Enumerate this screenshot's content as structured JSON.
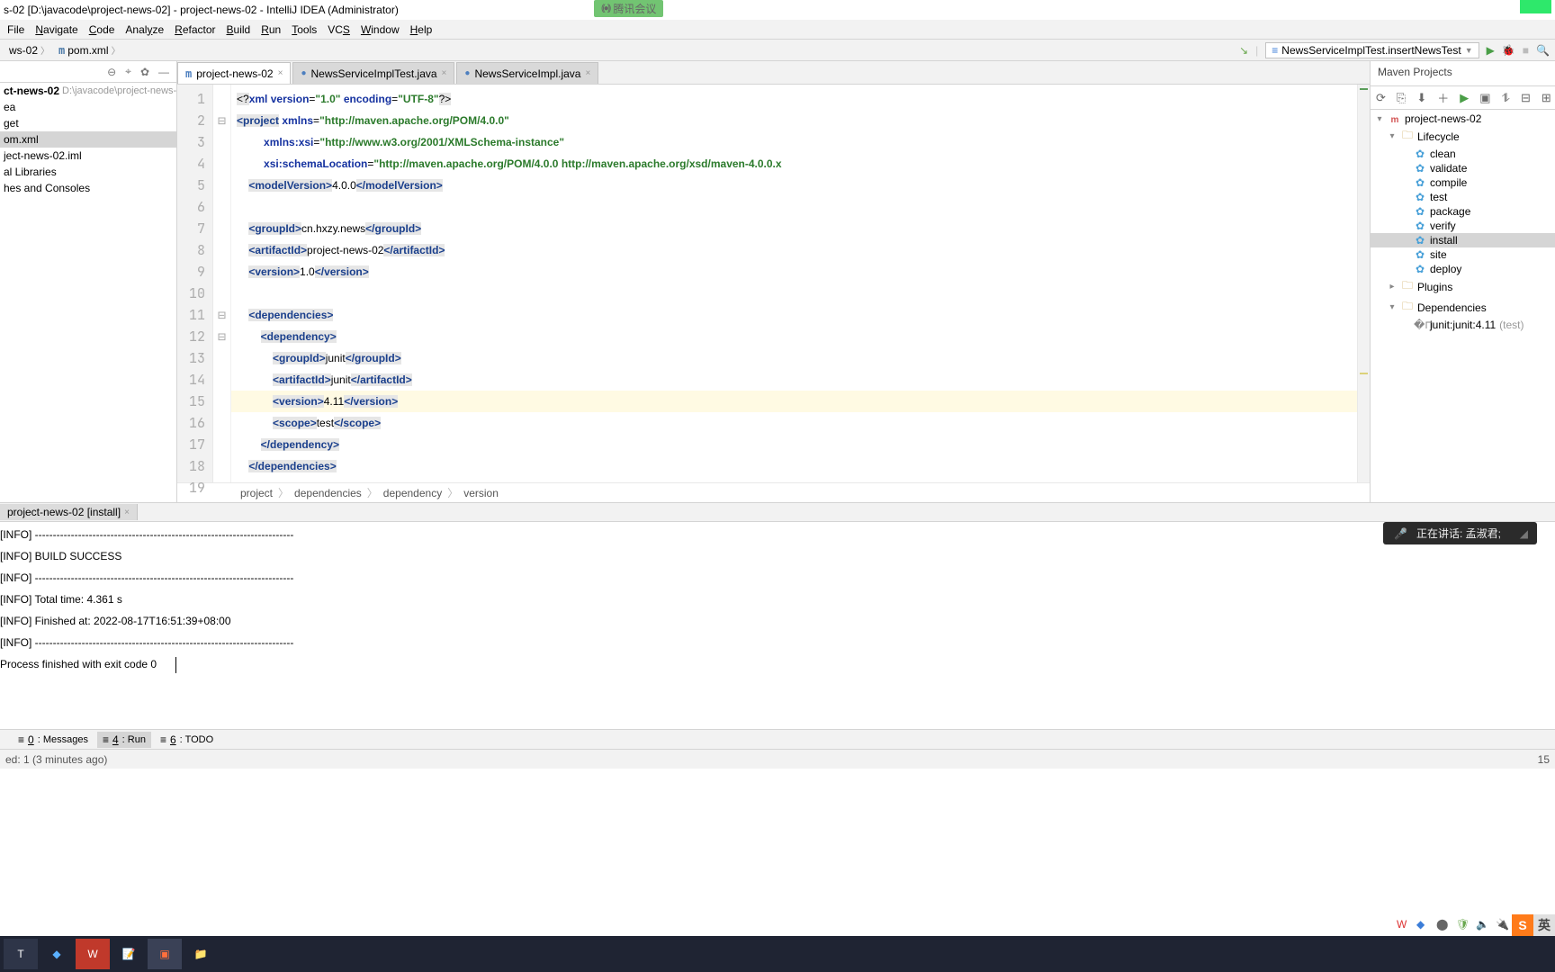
{
  "window": {
    "title": "s-02 [D:\\javacode\\project-news-02] - project-news-02 - IntelliJ IDEA (Administrator)",
    "meeting_badge": "腾讯会议"
  },
  "menu": [
    "File",
    "Navigate",
    "Code",
    "Analyze",
    "Refactor",
    "Build",
    "Run",
    "Tools",
    "VCS",
    "Window",
    "Help"
  ],
  "menu_underline_idx": [
    0,
    0,
    0,
    4,
    0,
    0,
    0,
    0,
    2,
    0,
    0
  ],
  "nav": {
    "crumbs": [
      "ws-02",
      "pom.xml"
    ],
    "run_config": "NewsServiceImplTest.insertNewsTest"
  },
  "project_tree": {
    "root": "ct-news-02",
    "root_hint": "D:\\javacode\\project-news-02",
    "items": [
      "ea",
      "get",
      "om.xml",
      "ject-news-02.iml",
      "al Libraries",
      "hes and Consoles"
    ],
    "selected_index": 2
  },
  "editor": {
    "tabs": [
      {
        "label": "project-news-02",
        "type": "m",
        "active": true
      },
      {
        "label": "NewsServiceImplTest.java",
        "type": "java"
      },
      {
        "label": "NewsServiceImpl.java",
        "type": "java"
      }
    ],
    "line_count": 19,
    "highlight_line": 15,
    "breadcrumbs": [
      "project",
      "dependencies",
      "dependency",
      "version"
    ],
    "code": {
      "l1": {
        "pre": "<?",
        "kw": "xml",
        "a1": "version",
        "v1": "\"1.0\"",
        "a2": "encoding",
        "v2": "\"UTF-8\"",
        "suf": "?>"
      },
      "l2": {
        "open": "<project",
        "a": "xmlns",
        "v": "\"http://maven.apache.org/POM/4.0.0\""
      },
      "l3": {
        "a": "xmlns:xsi",
        "v": "\"http://www.w3.org/2001/XMLSchema-instance\""
      },
      "l4": {
        "a": "xsi:schemaLocation",
        "v": "\"http://maven.apache.org/POM/4.0.0 http://maven.apache.org/xsd/maven-4.0.0.x"
      },
      "l5": {
        "tag": "modelVersion",
        "txt": "4.0.0"
      },
      "l7": {
        "tag": "groupId",
        "txt": "cn.hxzy.news"
      },
      "l8": {
        "tag": "artifactId",
        "txt": "project-news-02"
      },
      "l9": {
        "tag": "version",
        "txt": "1.0"
      },
      "l11": {
        "tag": "dependencies"
      },
      "l12": {
        "tag": "dependency"
      },
      "l13": {
        "tag": "groupId",
        "txt": "junit"
      },
      "l14": {
        "tag": "artifactId",
        "txt": "junit"
      },
      "l15": {
        "tag": "version",
        "txt": "4.11"
      },
      "l16": {
        "tag": "scope",
        "txt": "test"
      },
      "l17": {
        "close": "dependency"
      },
      "l18": {
        "close": "dependencies"
      }
    }
  },
  "maven": {
    "title": "Maven Projects",
    "root": "project-news-02",
    "lifecycle_label": "Lifecycle",
    "lifecycle": [
      "clean",
      "validate",
      "compile",
      "test",
      "package",
      "verify",
      "install",
      "site",
      "deploy"
    ],
    "lifecycle_selected": 6,
    "plugins": "Plugins",
    "dependencies": "Dependencies",
    "dep_item": "junit:junit:4.11",
    "dep_scope": "(test)"
  },
  "run": {
    "tab": "project-news-02 [install]",
    "lines": [
      "[INFO] ------------------------------------------------------------------------",
      "[INFO] BUILD SUCCESS",
      "[INFO] ------------------------------------------------------------------------",
      "[INFO] Total time: 4.361 s",
      "[INFO] Finished at: 2022-08-17T16:51:39+08:00",
      "[INFO] ------------------------------------------------------------------------",
      "",
      "Process finished with exit code 0"
    ]
  },
  "overlay": {
    "text": "正在讲话: 孟淑君;"
  },
  "bottom_tools": [
    {
      "key": "0",
      "label": "Messages"
    },
    {
      "key": "4",
      "label": "Run",
      "active": true
    },
    {
      "key": "6",
      "label": "TODO"
    }
  ],
  "status": {
    "left": "ed: 1 (3 minutes ago)",
    "right": "15"
  },
  "sogou": {
    "a": "S",
    "b": "英"
  }
}
